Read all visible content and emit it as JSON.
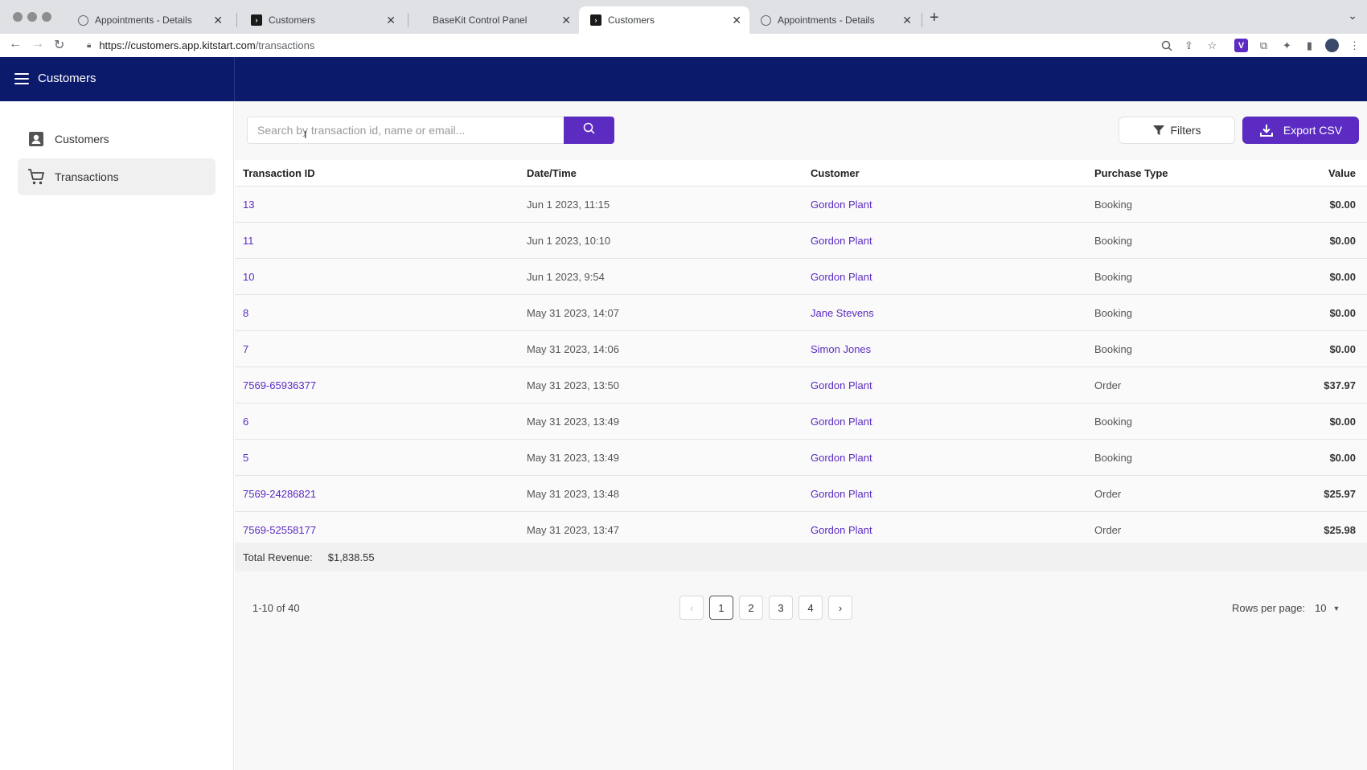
{
  "browser": {
    "tabs": [
      {
        "title": "Appointments - Details",
        "icon": "globe-icon"
      },
      {
        "title": "Customers",
        "icon": "kitstart-icon"
      },
      {
        "title": "BaseKit Control Panel",
        "icon": ""
      },
      {
        "title": "Customers",
        "icon": "kitstart-icon",
        "active": true
      },
      {
        "title": "Appointments - Details",
        "icon": "globe-icon"
      }
    ],
    "url_host": "https://customers.app.kitstart.com",
    "url_path": "/transactions"
  },
  "header": {
    "title": "Customers"
  },
  "sidebar": {
    "items": [
      {
        "label": "Customers",
        "icon": "contact-card-icon"
      },
      {
        "label": "Transactions",
        "icon": "shopping-cart-icon",
        "active": true
      }
    ]
  },
  "toolbar": {
    "search_placeholder": "Search by transaction id, name or email...",
    "filters_label": "Filters",
    "export_label": "Export CSV"
  },
  "table": {
    "columns": [
      "Transaction ID",
      "Date/Time",
      "Customer",
      "Purchase Type",
      "Value"
    ],
    "rows": [
      {
        "id": "13",
        "datetime": "Jun 1 2023, 11:15",
        "customer": "Gordon Plant",
        "type": "Booking",
        "value": "$0.00"
      },
      {
        "id": "11",
        "datetime": "Jun 1 2023, 10:10",
        "customer": "Gordon Plant",
        "type": "Booking",
        "value": "$0.00"
      },
      {
        "id": "10",
        "datetime": "Jun 1 2023, 9:54",
        "customer": "Gordon Plant",
        "type": "Booking",
        "value": "$0.00"
      },
      {
        "id": "8",
        "datetime": "May 31 2023, 14:07",
        "customer": "Jane Stevens",
        "type": "Booking",
        "value": "$0.00"
      },
      {
        "id": "7",
        "datetime": "May 31 2023, 14:06",
        "customer": "Simon Jones",
        "type": "Booking",
        "value": "$0.00"
      },
      {
        "id": "7569-65936377",
        "datetime": "May 31 2023, 13:50",
        "customer": "Gordon Plant",
        "type": "Order",
        "value": "$37.97"
      },
      {
        "id": "6",
        "datetime": "May 31 2023, 13:49",
        "customer": "Gordon Plant",
        "type": "Booking",
        "value": "$0.00"
      },
      {
        "id": "5",
        "datetime": "May 31 2023, 13:49",
        "customer": "Gordon Plant",
        "type": "Booking",
        "value": "$0.00"
      },
      {
        "id": "7569-24286821",
        "datetime": "May 31 2023, 13:48",
        "customer": "Gordon Plant",
        "type": "Order",
        "value": "$25.97"
      },
      {
        "id": "7569-52558177",
        "datetime": "May 31 2023, 13:47",
        "customer": "Gordon Plant",
        "type": "Order",
        "value": "$25.98"
      }
    ]
  },
  "revenue": {
    "label": "Total Revenue:",
    "amount": "$1,838.55"
  },
  "pagination": {
    "range_text": "1-10 of 40",
    "pages": [
      "1",
      "2",
      "3",
      "4"
    ],
    "current_page": "1",
    "rows_per_page_label": "Rows per page:",
    "rows_per_page_value": "10"
  },
  "colors": {
    "header_bg": "#0c1a6b",
    "accent": "#5b2bc2"
  }
}
